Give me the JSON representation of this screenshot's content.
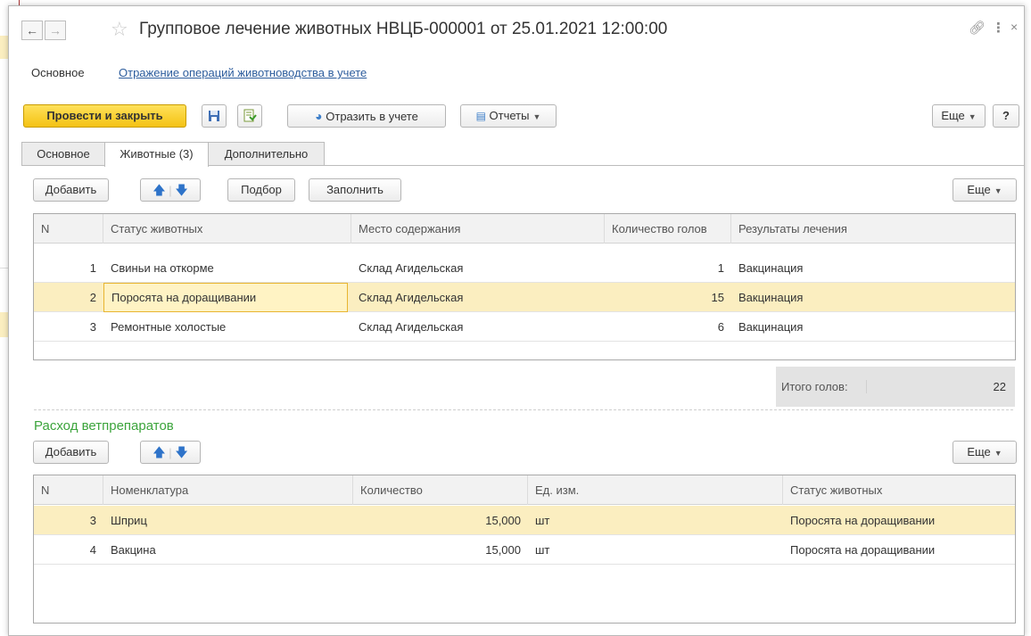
{
  "window": {
    "title": "Групповое лечение животных НВЦБ-000001 от 25.01.2021 12:00:00"
  },
  "nav": {
    "main": "Основное",
    "link": "Отражение операций животноводства в учете"
  },
  "toolbar": {
    "post_close": "Провести и закрыть",
    "reflect": "Отразить в учете",
    "reports": "Отчеты",
    "more": "Еще",
    "help": "?"
  },
  "tabs": [
    {
      "label": "Основное"
    },
    {
      "label": "Животные (3)"
    },
    {
      "label": "Дополнительно"
    }
  ],
  "animals": {
    "add": "Добавить",
    "select": "Подбор",
    "fill": "Заполнить",
    "more": "Еще",
    "columns": [
      "N",
      "Статус животных",
      "Место содержания",
      "Количество голов",
      "Результаты лечения"
    ],
    "rows": [
      {
        "n": "1",
        "status": "Свиньи на откорме",
        "place": "Склад Агидельская",
        "qty": "1",
        "result": "Вакцинация"
      },
      {
        "n": "2",
        "status": "Поросята на доращивании",
        "place": "Склад Агидельская",
        "qty": "15",
        "result": "Вакцинация"
      },
      {
        "n": "3",
        "status": "Ремонтные холостые",
        "place": "Склад Агидельская",
        "qty": "6",
        "result": "Вакцинация"
      }
    ],
    "total_label": "Итого голов:",
    "total_value": "22"
  },
  "drugs": {
    "title": "Расход ветпрепаратов",
    "add": "Добавить",
    "more": "Еще",
    "columns": [
      "N",
      "Номенклатура",
      "Количество",
      "Ед. изм.",
      "Статус животных"
    ],
    "rows": [
      {
        "n": "3",
        "name": "Шприц",
        "qty": "15,000",
        "unit": "шт",
        "status": "Поросята на доращивании"
      },
      {
        "n": "4",
        "name": "Вакцина",
        "qty": "15,000",
        "unit": "шт",
        "status": "Поросята на доращивании"
      }
    ]
  }
}
